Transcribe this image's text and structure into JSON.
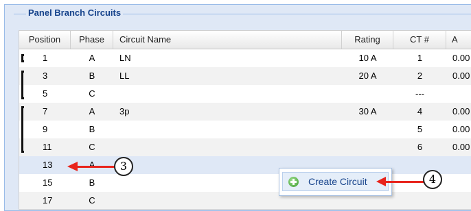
{
  "panel": {
    "title": "Panel Branch Circuits"
  },
  "columns": {
    "position": "Position",
    "phase": "Phase",
    "name": "Circuit Name",
    "rating": "Rating",
    "ct": "CT #",
    "a": "A"
  },
  "rows": [
    {
      "position": "1",
      "phase": "A",
      "name": "LN",
      "rating": "10 A",
      "ct": "1",
      "a": "0.00"
    },
    {
      "position": "3",
      "phase": "B",
      "name": "LL",
      "rating": "20 A",
      "ct": "2",
      "a": "0.00"
    },
    {
      "position": "5",
      "phase": "C",
      "name": "",
      "rating": "",
      "ct": "---",
      "a": ""
    },
    {
      "position": "7",
      "phase": "A",
      "name": "3p",
      "rating": "30 A",
      "ct": "4",
      "a": "0.00"
    },
    {
      "position": "9",
      "phase": "B",
      "name": "",
      "rating": "",
      "ct": "5",
      "a": "0.00"
    },
    {
      "position": "11",
      "phase": "C",
      "name": "",
      "rating": "",
      "ct": "6",
      "a": "0.00"
    },
    {
      "position": "13",
      "phase": "A",
      "name": "",
      "rating": "",
      "ct": "",
      "a": ""
    },
    {
      "position": "15",
      "phase": "B",
      "name": "",
      "rating": "",
      "ct": "",
      "a": ""
    },
    {
      "position": "17",
      "phase": "C",
      "name": "",
      "rating": "",
      "ct": "",
      "a": ""
    }
  ],
  "context_menu": {
    "create_circuit": "Create Circuit",
    "icon": "add-icon"
  },
  "callouts": {
    "c3": "3",
    "c4": "4"
  },
  "colors": {
    "accent": "#15428b",
    "arrow": "#e8241c",
    "selection": "#dfe8f6"
  }
}
